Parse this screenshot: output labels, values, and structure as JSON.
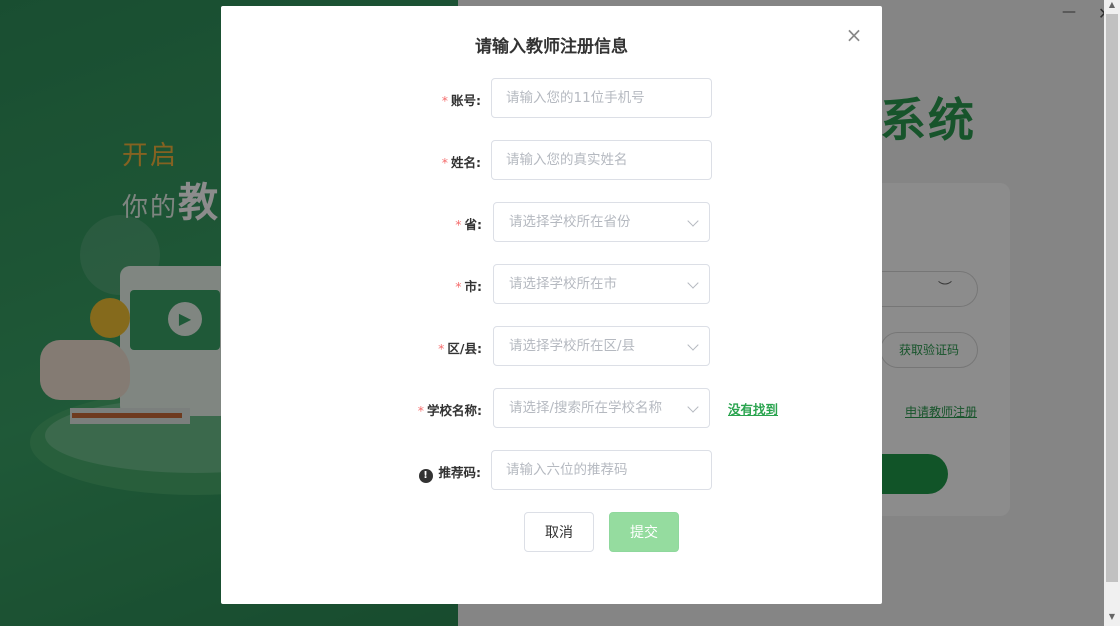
{
  "background": {
    "slogan_line1": "开启",
    "slogan_line2_prefix": "你的",
    "slogan_line2_strong": "教",
    "app_title_partial": "系统",
    "login": {
      "get_code_label": "获取验证码",
      "register_link": "申请教师注册",
      "eye_icon": "eye-closed-icon"
    }
  },
  "window": {
    "minimize_icon": "minimize-icon",
    "close_icon": "close-icon"
  },
  "dialog": {
    "title": "请输入教师注册信息",
    "close_symbol": "×",
    "fields": {
      "account": {
        "label": "账号:",
        "placeholder": "请输入您的11位手机号"
      },
      "name": {
        "label": "姓名:",
        "placeholder": "请输入您的真实姓名"
      },
      "province": {
        "label": "省:",
        "placeholder": "请选择学校所在省份"
      },
      "city": {
        "label": "市:",
        "placeholder": "请选择学校所在市"
      },
      "district": {
        "label": "区/县:",
        "placeholder": "请选择学校所在区/县"
      },
      "school": {
        "label": "学校名称:",
        "placeholder": "请选择/搜索所在学校名称"
      },
      "referral": {
        "label": "推荐码:",
        "placeholder": "请输入六位的推荐码"
      }
    },
    "required_mark": "*",
    "info_symbol": "!",
    "not_found_link": "没有找到",
    "buttons": {
      "cancel": "取消",
      "submit": "提交"
    }
  },
  "colors": {
    "brand_green": "#2a9a4f",
    "required_red": "#f56c6c",
    "submit_disabled": "#95dc9f"
  }
}
